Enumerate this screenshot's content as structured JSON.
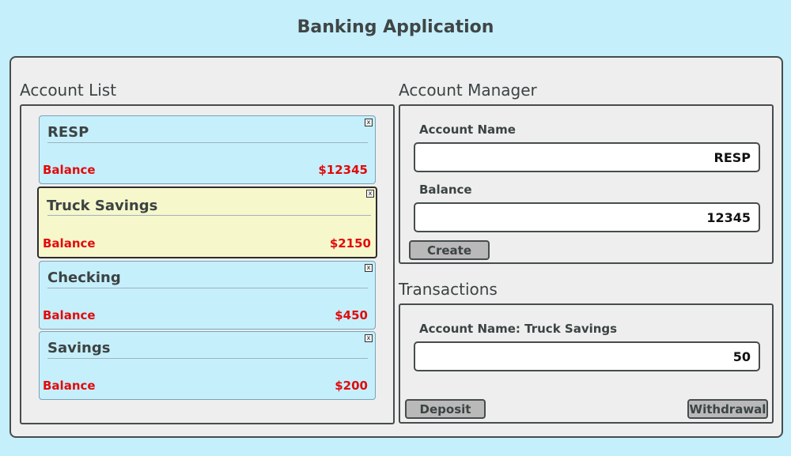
{
  "app": {
    "title": "Banking Application"
  },
  "account_list": {
    "title": "Account List",
    "close_glyph": "x",
    "accounts": [
      {
        "name": "RESP",
        "balance_label": "Balance",
        "balance": "$12345"
      },
      {
        "name": "Truck Savings",
        "balance_label": "Balance",
        "balance": "$2150",
        "selected": true
      },
      {
        "name": "Checking",
        "balance_label": "Balance",
        "balance": "$450"
      },
      {
        "name": "Savings",
        "balance_label": "Balance",
        "balance": "$200"
      }
    ]
  },
  "account_manager": {
    "title": "Account Manager",
    "name_label": "Account Name",
    "name_value": "RESP",
    "balance_label": "Balance",
    "balance_value": "12345",
    "create_label": "Create"
  },
  "transactions": {
    "title": "Transactions",
    "account_label": "Account Name: Truck Savings",
    "amount_value": "50",
    "deposit_label": "Deposit",
    "withdraw_label": "Withdrawal"
  },
  "colors": {
    "background": "#c6effc",
    "panel": "#eeeeee",
    "card": "#c6effc",
    "selected_card": "#f7f7cc",
    "balance_text": "#e10b0b",
    "button": "#b9b9b9"
  },
  "icons": {
    "card_close": "close-icon"
  }
}
